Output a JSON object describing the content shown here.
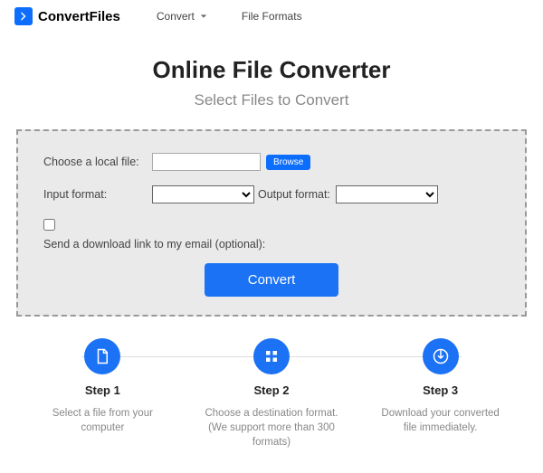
{
  "header": {
    "brand": "ConvertFiles",
    "nav": {
      "convert": "Convert",
      "formats": "File Formats"
    }
  },
  "main": {
    "title": "Online File Converter",
    "subtitle": "Select Files to Convert"
  },
  "form": {
    "choose_label": "Choose a local file:",
    "browse": "Browse",
    "input_label": "Input format:",
    "output_label": "Output format:",
    "email_label": "Send a download link to my email (optional):",
    "convert_btn": "Convert"
  },
  "steps": [
    {
      "title": "Step 1",
      "desc": "Select a file from your computer"
    },
    {
      "title": "Step 2",
      "desc": "Choose a destination format. (We support more than 300 formats)"
    },
    {
      "title": "Step 3",
      "desc": "Download your converted file immediately."
    }
  ]
}
